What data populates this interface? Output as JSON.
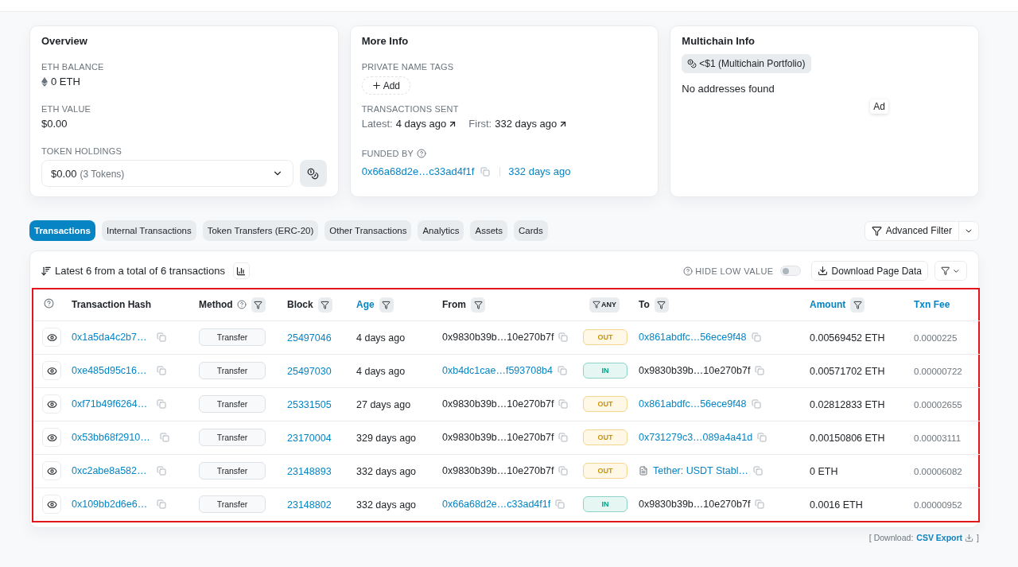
{
  "overview": {
    "title": "Overview",
    "eth_balance": {
      "label": "ETH BALANCE",
      "value": "0 ETH"
    },
    "eth_value": {
      "label": "ETH VALUE",
      "value": "$0.00"
    },
    "token_holdings": {
      "label": "TOKEN HOLDINGS",
      "value": "$0.00",
      "count": "(3 Tokens)"
    }
  },
  "more_info": {
    "title": "More Info",
    "private_name_tags": {
      "label": "PRIVATE NAME TAGS",
      "button": "Add"
    },
    "transactions_sent": {
      "label": "TRANSACTIONS SENT",
      "latest_label": "Latest:",
      "latest": "4 days ago",
      "first_label": "First:",
      "first": "332 days ago"
    },
    "funded_by": {
      "label": "FUNDED BY",
      "address": "0x66a68d2e…c33ad4f1f",
      "age": "332 days ago"
    }
  },
  "multichain_info": {
    "title": "Multichain Info",
    "portfolio": "<$1 (Multichain Portfolio)",
    "message": "No addresses found",
    "ad": "Ad"
  },
  "tabs": [
    {
      "label": "Transactions",
      "selected": true
    },
    {
      "label": "Internal Transactions",
      "selected": false
    },
    {
      "label": "Token Transfers (ERC-20)",
      "selected": false
    },
    {
      "label": "Other Transactions",
      "selected": false
    },
    {
      "label": "Analytics",
      "selected": false
    },
    {
      "label": "Assets",
      "selected": false
    },
    {
      "label": "Cards",
      "selected": false
    }
  ],
  "advanced_filter": "Advanced Filter",
  "transactions": {
    "summary": "Latest 6 from a total of 6 transactions",
    "hide_low_value": {
      "label": "HIDE LOW VALUE",
      "on": false
    },
    "download_button": "Download Page Data",
    "columns": [
      {
        "kind": "help"
      },
      {
        "kind": "heading",
        "label": "Transaction Hash",
        "help": false,
        "filter": false,
        "sortable": false
      },
      {
        "kind": "heading",
        "label": "Method",
        "help": true,
        "filter": true,
        "sortable": false
      },
      {
        "kind": "heading",
        "label": "Block",
        "help": false,
        "filter": true,
        "sortable": false
      },
      {
        "kind": "heading",
        "label": "Age",
        "help": false,
        "filter": true,
        "sortable": true
      },
      {
        "kind": "heading",
        "label": "From",
        "help": false,
        "filter": true,
        "sortable": false
      },
      {
        "kind": "filter_chip",
        "label": "ANY"
      },
      {
        "kind": "heading",
        "label": "To",
        "help": false,
        "filter": true,
        "sortable": false
      },
      {
        "kind": "heading",
        "label": "Amount",
        "help": false,
        "filter": true,
        "sortable": true
      },
      {
        "kind": "heading",
        "label": "Txn Fee",
        "help": false,
        "filter": false,
        "sortable": true
      }
    ],
    "rows": [
      {
        "hash": "0x1a5da4c2b7…",
        "method": "Transfer",
        "block": "25497046",
        "age": "4 days ago",
        "from": {
          "text": "0x9830b39b…10e270b7f",
          "linked": false
        },
        "direction": {
          "kind": "out",
          "label": "OUT"
        },
        "to": {
          "kind": "address",
          "text": "0x861abdfc…56ece9f48",
          "linked": true
        },
        "amount": "0.00569452 ETH",
        "fee": "0.0000225"
      },
      {
        "hash": "0xe485d95c16…",
        "method": "Transfer",
        "block": "25497030",
        "age": "4 days ago",
        "from": {
          "text": "0xb4dc1cae…f593708b4",
          "linked": true
        },
        "direction": {
          "kind": "in",
          "label": "IN"
        },
        "to": {
          "kind": "address",
          "text": "0x9830b39b…10e270b7f",
          "linked": false
        },
        "amount": "0.00571702 ETH",
        "fee": "0.00000722"
      },
      {
        "hash": "0xf71b49f6264…",
        "method": "Transfer",
        "block": "25331505",
        "age": "27 days ago",
        "from": {
          "text": "0x9830b39b…10e270b7f",
          "linked": false
        },
        "direction": {
          "kind": "out",
          "label": "OUT"
        },
        "to": {
          "kind": "address",
          "text": "0x861abdfc…56ece9f48",
          "linked": true
        },
        "amount": "0.02812833 ETH",
        "fee": "0.00002655"
      },
      {
        "hash": "0x53bb68f2910…",
        "method": "Transfer",
        "block": "23170004",
        "age": "329 days ago",
        "from": {
          "text": "0x9830b39b…10e270b7f",
          "linked": false
        },
        "direction": {
          "kind": "out",
          "label": "OUT"
        },
        "to": {
          "kind": "address",
          "text": "0x731279c3…089a4a41d",
          "linked": true
        },
        "amount": "0.00150806 ETH",
        "fee": "0.00003111"
      },
      {
        "hash": "0xc2abe8a582…",
        "method": "Transfer",
        "block": "23148893",
        "age": "332 days ago",
        "from": {
          "text": "0x9830b39b…10e270b7f",
          "linked": false
        },
        "direction": {
          "kind": "out",
          "label": "OUT"
        },
        "to": {
          "kind": "contract",
          "text": "Tether: USDT Stabl…",
          "linked": true
        },
        "amount": "0 ETH",
        "fee": "0.00006082"
      },
      {
        "hash": "0x109bb2d6e6…",
        "method": "Transfer",
        "block": "23148802",
        "age": "332 days ago",
        "from": {
          "text": "0x66a68d2e…c33ad4f1f",
          "linked": true
        },
        "direction": {
          "kind": "in",
          "label": "IN"
        },
        "to": {
          "kind": "address",
          "text": "0x9830b39b…10e270b7f",
          "linked": false
        },
        "amount": "0.0016 ETH",
        "fee": "0.00000952"
      }
    ]
  },
  "footer": {
    "prefix": "[ Download:",
    "link": "CSV Export",
    "suffix": "]"
  }
}
